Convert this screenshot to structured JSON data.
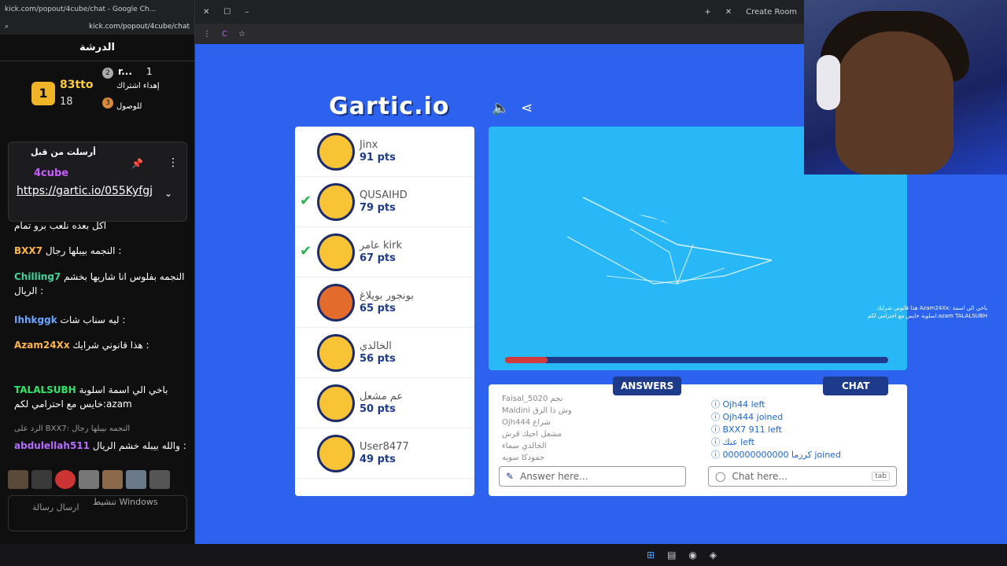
{
  "leftchat": {
    "window_title": "kick.com/popout/4cube/chat - Google Ch...",
    "url": "kick.com/popout/4cube/chat",
    "chat_title": "الدرشة",
    "leader": {
      "rank": "1",
      "name": "83tto",
      "count": "18"
    },
    "second": {
      "rank": "2",
      "name": "r...",
      "count": "1"
    },
    "third": {
      "rank": "3",
      "label": "إهداء اشتراك"
    },
    "third_sub": "للوصول",
    "pinned": {
      "header": "أرسلت من قبل",
      "user": "4cube",
      "link": "https://gartic.io/055Kyfgj"
    },
    "messages": [
      {
        "user": "",
        "text": "اكل بعده نلعب برو تمام",
        "color": "#fff"
      },
      {
        "user": "BXX7",
        "text": "النجمه بيبلها رجال :",
        "color": "#ffb648"
      },
      {
        "user": "Chilling7",
        "text": "النجمه بفلوس انا شاريها بخشم الريال :",
        "color": "#3bd6a0"
      },
      {
        "user": "Ihhkggk",
        "text": "ليه سناب شات :",
        "color": "#6aa6ff"
      },
      {
        "user": "Azam24Xx",
        "text": "هذا قانوني شرايك :",
        "color": "#ffb648"
      },
      {
        "user": "TALALSUBH",
        "text": "باخي الي اسمة اسلوبة خايس مع احترامي لكم:azam",
        "color": "#2ee66b"
      },
      {
        "user": "abdulellah511",
        "text": "والله بيبله خشم الريال :",
        "color": "#b56cff"
      }
    ],
    "reply_hint": "الرد على BXX7: النجمه بيبلها رجال",
    "send_placeholder": "ارسال رسالة",
    "windows_note": "تنشيط Windows"
  },
  "browser": {
    "tab_label": "Create Room",
    "logo": "Gartic.io"
  },
  "players": [
    {
      "name": "Jinx",
      "pts": "91 pts",
      "check": false
    },
    {
      "name": "QUSAIHD",
      "pts": "79 pts",
      "check": true
    },
    {
      "name": "عامر kirk",
      "pts": "67 pts",
      "check": true
    },
    {
      "name": "بونجور بويلاغ",
      "pts": "65 pts",
      "check": false
    },
    {
      "name": "الخالدي",
      "pts": "56 pts",
      "check": false
    },
    {
      "name": "عم مشعل",
      "pts": "50 pts",
      "check": false
    },
    {
      "name": "User8477",
      "pts": "49 pts",
      "check": false
    }
  ],
  "progress": 0.11,
  "answers_label": "ANSWERS",
  "chat_label": "CHAT",
  "answers": [
    "Faisal_5020 نجم",
    "Maldini وش ذا الزق",
    "Ojh444 شراع",
    "مشعل احبك قرش",
    "الخالدي سماء",
    "حمودكا سويه"
  ],
  "chat": [
    "Ojh44 left",
    "Ojh444 joined",
    "BXX7 911 left",
    "عنك left",
    "000000000000 كرزما joined"
  ],
  "answer_placeholder": "Answer here...",
  "chat_placeholder": "Chat here...",
  "chat_tab": "tab",
  "overlay": "هذا قانوني شرايك Azam24Xx: باخي الي اسمة اسلوبة خايس مع احترامي لكم:azam TALALSUBH"
}
